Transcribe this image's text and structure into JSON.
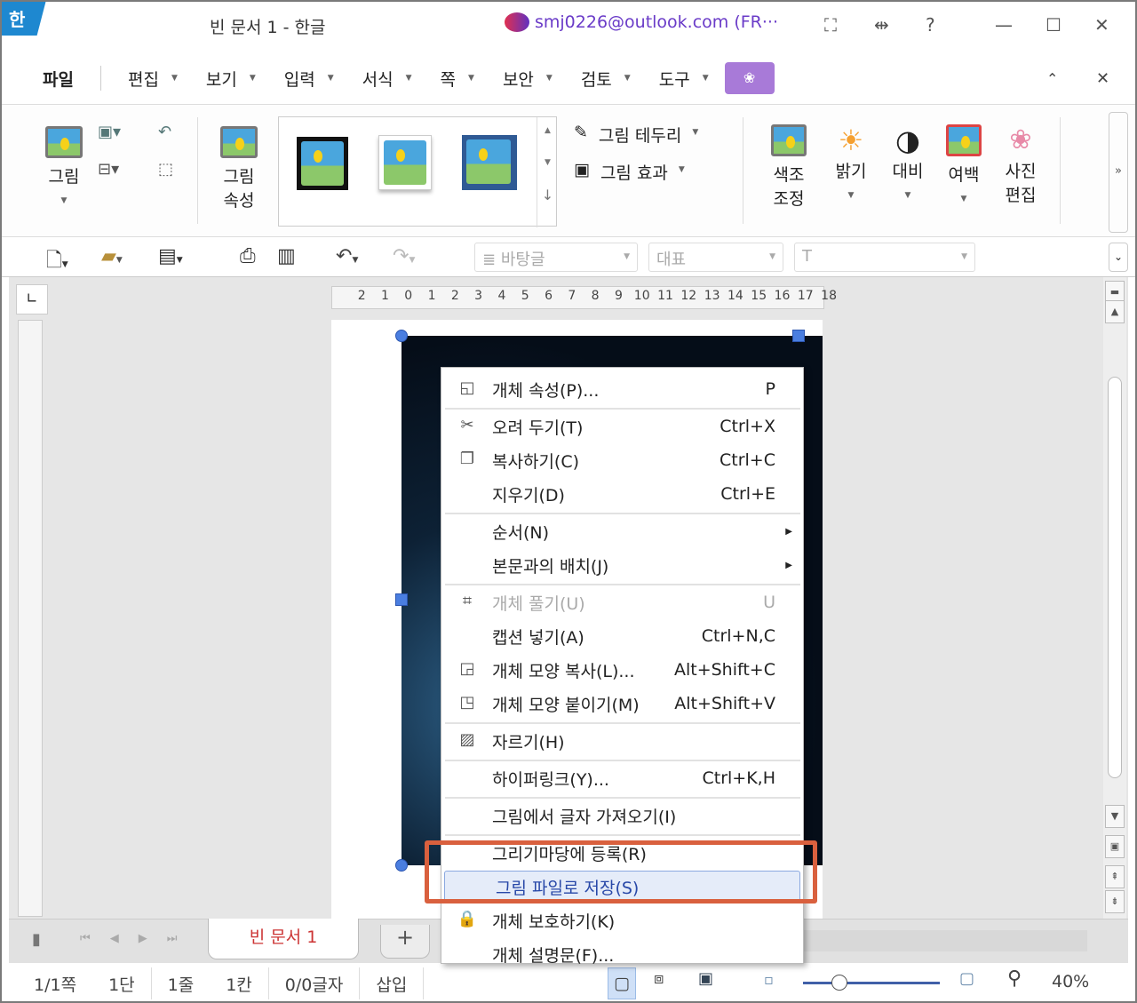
{
  "app": {
    "logo": "한",
    "title": "빈 문서 1 - 한글",
    "account": "smj0226@outlook.com (FR···"
  },
  "menubar": {
    "items": [
      "파일",
      "편집",
      "보기",
      "입력",
      "서식",
      "쪽",
      "보안",
      "검토",
      "도구"
    ]
  },
  "ribbon": {
    "picture": "그림",
    "picture_props": [
      "그림",
      "속성"
    ],
    "border": "그림 테두리",
    "effect": "그림 효과",
    "color_adjust": [
      "색조",
      "조정"
    ],
    "brightness": "밝기",
    "contrast": "대비",
    "margin": "여백",
    "photo_edit": [
      "사진",
      "편집"
    ]
  },
  "toolbar": {
    "style_combo": "바탕글",
    "font_group": "대표"
  },
  "ruler": {
    "h_ticks": [
      "2",
      "1",
      "0",
      "1",
      "2",
      "3",
      "4",
      "5",
      "6",
      "7",
      "8",
      "9",
      "10",
      "11",
      "12",
      "13",
      "14",
      "15",
      "16",
      "17",
      "18"
    ]
  },
  "context_menu": {
    "items": [
      {
        "label": "개체 속성(P)...",
        "shortcut": "P",
        "icon": "object-properties-icon"
      },
      {
        "sep": true
      },
      {
        "label": "오려 두기(T)",
        "shortcut": "Ctrl+X",
        "icon": "scissors-icon"
      },
      {
        "label": "복사하기(C)",
        "shortcut": "Ctrl+C",
        "icon": "copy-icon"
      },
      {
        "label": "지우기(D)",
        "shortcut": "Ctrl+E"
      },
      {
        "sep": true
      },
      {
        "label": "순서(N)",
        "submenu": true
      },
      {
        "label": "본문과의 배치(J)",
        "submenu": true
      },
      {
        "sep": true
      },
      {
        "label": "개체 풀기(U)",
        "shortcut": "U",
        "disabled": true,
        "icon": "ungroup-icon"
      },
      {
        "label": "캡션 넣기(A)",
        "shortcut": "Ctrl+N,C"
      },
      {
        "label": "개체 모양 복사(L)...",
        "shortcut": "Alt+Shift+C",
        "icon": "copy-shape-icon"
      },
      {
        "label": "개체 모양 붙이기(M)",
        "shortcut": "Alt+Shift+V",
        "icon": "paste-shape-icon"
      },
      {
        "sep": true
      },
      {
        "label": "자르기(H)",
        "icon": "crop-icon"
      },
      {
        "sep": true
      },
      {
        "label": "하이퍼링크(Y)...",
        "shortcut": "Ctrl+K,H"
      },
      {
        "sep": true
      },
      {
        "label": "그림에서 글자 가져오기(I)"
      },
      {
        "sep": true
      },
      {
        "label": "그리기마당에 등록(R)"
      },
      {
        "label": "그림 파일로 저장(S)",
        "highlighted": true
      },
      {
        "label": "개체 보호하기(K)",
        "icon": "lock-icon"
      },
      {
        "label": "개체 설명문(F)..."
      }
    ]
  },
  "tabs": {
    "doc": "빈 문서 1",
    "add": "+"
  },
  "status": {
    "page": "1/1쪽",
    "col": "1단",
    "line": "1줄",
    "pos": "1칸",
    "chars": "0/0글자",
    "mode": "삽입",
    "zoom": "40%",
    "zoom_value": 40
  },
  "colors": {
    "accent": "#4a7ee0",
    "highlight_box": "#d9603e",
    "tab_text": "#cc3333"
  }
}
